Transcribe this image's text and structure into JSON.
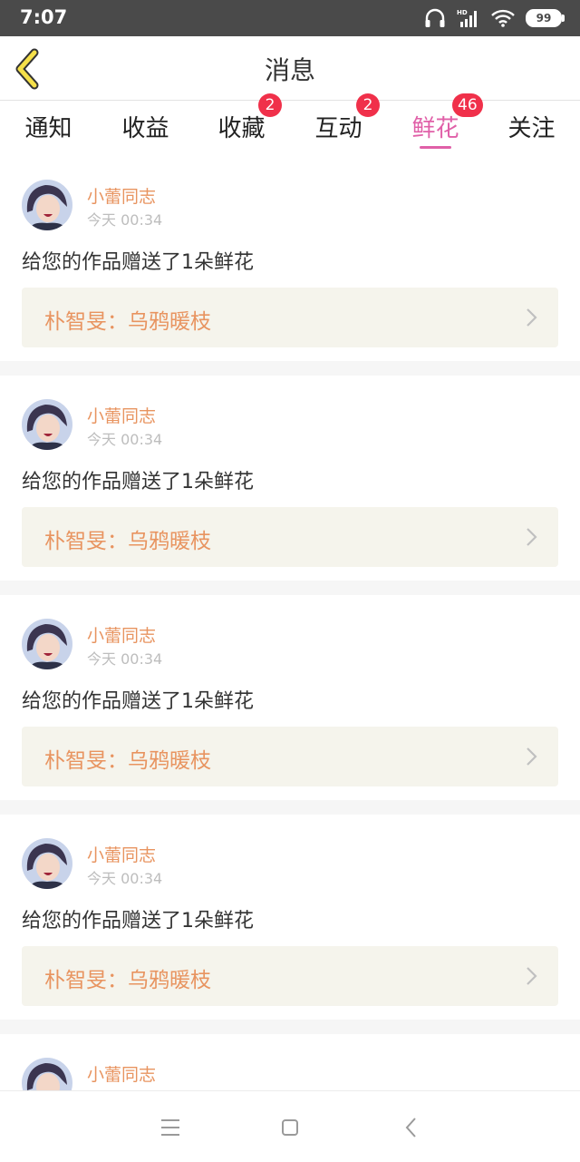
{
  "status_bar": {
    "time": "7:07",
    "hd_label": "HD",
    "battery": "99"
  },
  "header": {
    "title": "消息",
    "back_icon": "chevron-left-icon"
  },
  "tabs": [
    {
      "label": "通知",
      "badge": null,
      "active": false
    },
    {
      "label": "收益",
      "badge": null,
      "active": false
    },
    {
      "label": "收藏",
      "badge": "2",
      "active": false
    },
    {
      "label": "互动",
      "badge": "2",
      "active": false
    },
    {
      "label": "鲜花",
      "badge": "46",
      "active": true
    },
    {
      "label": "关注",
      "badge": null,
      "active": false
    }
  ],
  "messages": [
    {
      "sender": "小蕾同志",
      "time": "今天 00:34",
      "text": "给您的作品赠送了1朵鲜花",
      "work": "朴智旻：乌鸦暖枝"
    },
    {
      "sender": "小蕾同志",
      "time": "今天 00:34",
      "text": "给您的作品赠送了1朵鲜花",
      "work": "朴智旻：乌鸦暖枝"
    },
    {
      "sender": "小蕾同志",
      "time": "今天 00:34",
      "text": "给您的作品赠送了1朵鲜花",
      "work": "朴智旻：乌鸦暖枝"
    },
    {
      "sender": "小蕾同志",
      "time": "今天 00:34",
      "text": "给您的作品赠送了1朵鲜花",
      "work": "朴智旻：乌鸦暖枝"
    },
    {
      "sender": "小蕾同志",
      "time": "",
      "text": "",
      "work": ""
    }
  ],
  "colors": {
    "accent_pink": "#e060a8",
    "sender_orange": "#e89460",
    "badge_red": "#f0304a",
    "back_yellow": "#f5e04a",
    "card_bg": "#f5f4ec"
  },
  "nav_bar": {
    "icons": [
      "menu-icon",
      "home-square-icon",
      "back-triangle-icon"
    ]
  }
}
